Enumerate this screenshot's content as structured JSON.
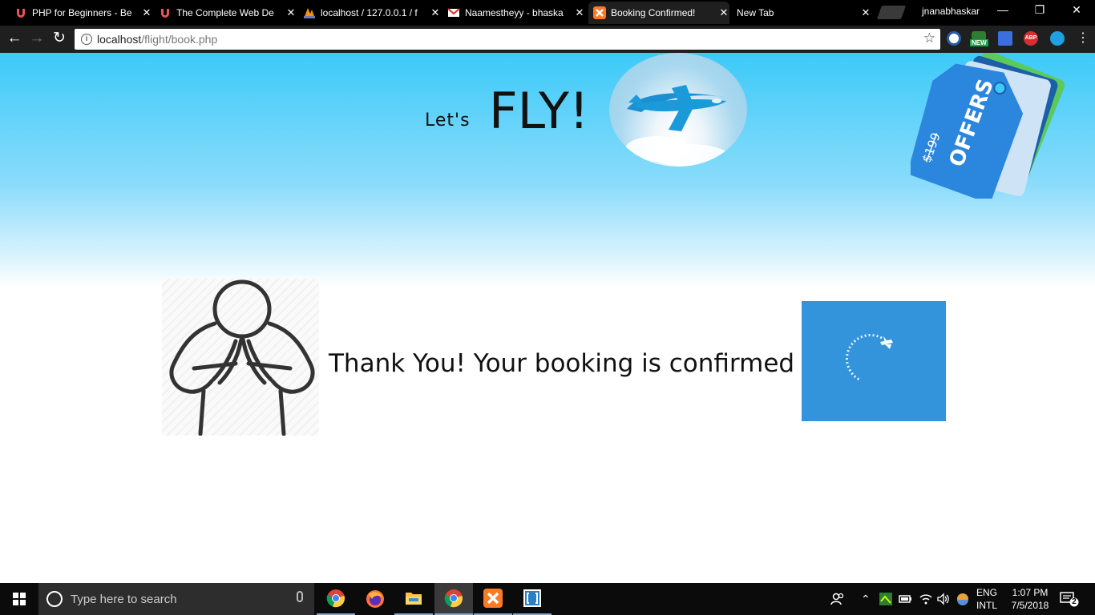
{
  "browser": {
    "tabs": [
      {
        "title": "PHP for Beginners - Be",
        "favicon": "udemy-icon",
        "active": false
      },
      {
        "title": "The Complete Web De",
        "favicon": "udemy-icon",
        "active": false
      },
      {
        "title": "localhost / 127.0.0.1 / f",
        "favicon": "phpmyadmin-icon",
        "active": false
      },
      {
        "title": "Naamestheyy - bhaska",
        "favicon": "gmail-icon",
        "active": false
      },
      {
        "title": "Booking Confirmed!",
        "favicon": "xampp-icon",
        "active": true
      },
      {
        "title": "New Tab",
        "favicon": "",
        "active": false
      }
    ],
    "tab_close": "✕",
    "profile_name": "jnanabhaskar",
    "url_host": "localhost",
    "url_path": "/flight/book.php",
    "new_badge": "NEW",
    "abp_label": "ABP"
  },
  "page": {
    "brand_small": "Let's",
    "brand_big": "FLY!",
    "offers_label": "OFFERS",
    "offers_price": "$199",
    "message": "Thank You! Your booking is confirmed"
  },
  "taskbar": {
    "search_placeholder": "Type here to search",
    "lang_top": "ENG",
    "lang_bottom": "INTL",
    "time": "1:07 PM",
    "date": "7/5/2018",
    "notification_count": "2"
  },
  "colors": {
    "sky_top": "#3ccaf8",
    "loader_bg": "#3394db",
    "tag_blue": "#2b86de",
    "tag_green": "#5cc95c"
  }
}
